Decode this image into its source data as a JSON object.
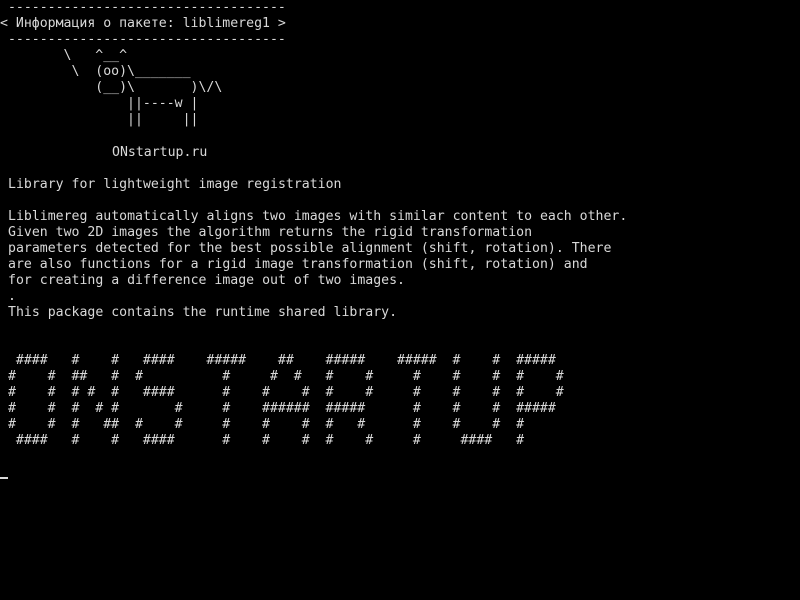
{
  "terminal": {
    "colors": {
      "background": "#000000",
      "foreground": "#d9d9d9"
    },
    "bubble": {
      "top_border": " -----------------------------------",
      "title": "< Информация о пакете: liblimereg1 >",
      "bottom_border": " -----------------------------------"
    },
    "cow": [
      "        \\   ^__^",
      "         \\  (oo)\\_______",
      "            (__)\\       )\\/\\",
      "                ||----w |",
      "                ||     ||"
    ],
    "site": "ONstartup.ru",
    "summary": "Library for lightweight image registration",
    "description": [
      "Liblimereg automatically aligns two images with similar content to each other.",
      "Given two 2D images the algorithm returns the rigid transformation",
      "parameters detected for the best possible alignment (shift, rotation). There",
      "are also functions for a rigid image transformation (shift, rotation) and",
      "for creating a difference image out of two images.",
      ".",
      "This package contains the runtime shared library."
    ],
    "banner": [
      "  ####   #    #   ####    #####    ##    #####    #####  #    #  #####",
      " #    #  ##   #  #          #     #  #   #    #     #    #    #  #    #",
      " #    #  # #  #   ####      #    #    #  #    #     #    #    #  #    #",
      " #    #  #  # #       #     #    ######  #####      #    #    #  #####",
      " #    #  #   ##  #    #     #    #    #  #   #      #    #    #  #",
      "  ####   #    #   ####      #    #    #  #    #     #     ####   #"
    ]
  }
}
